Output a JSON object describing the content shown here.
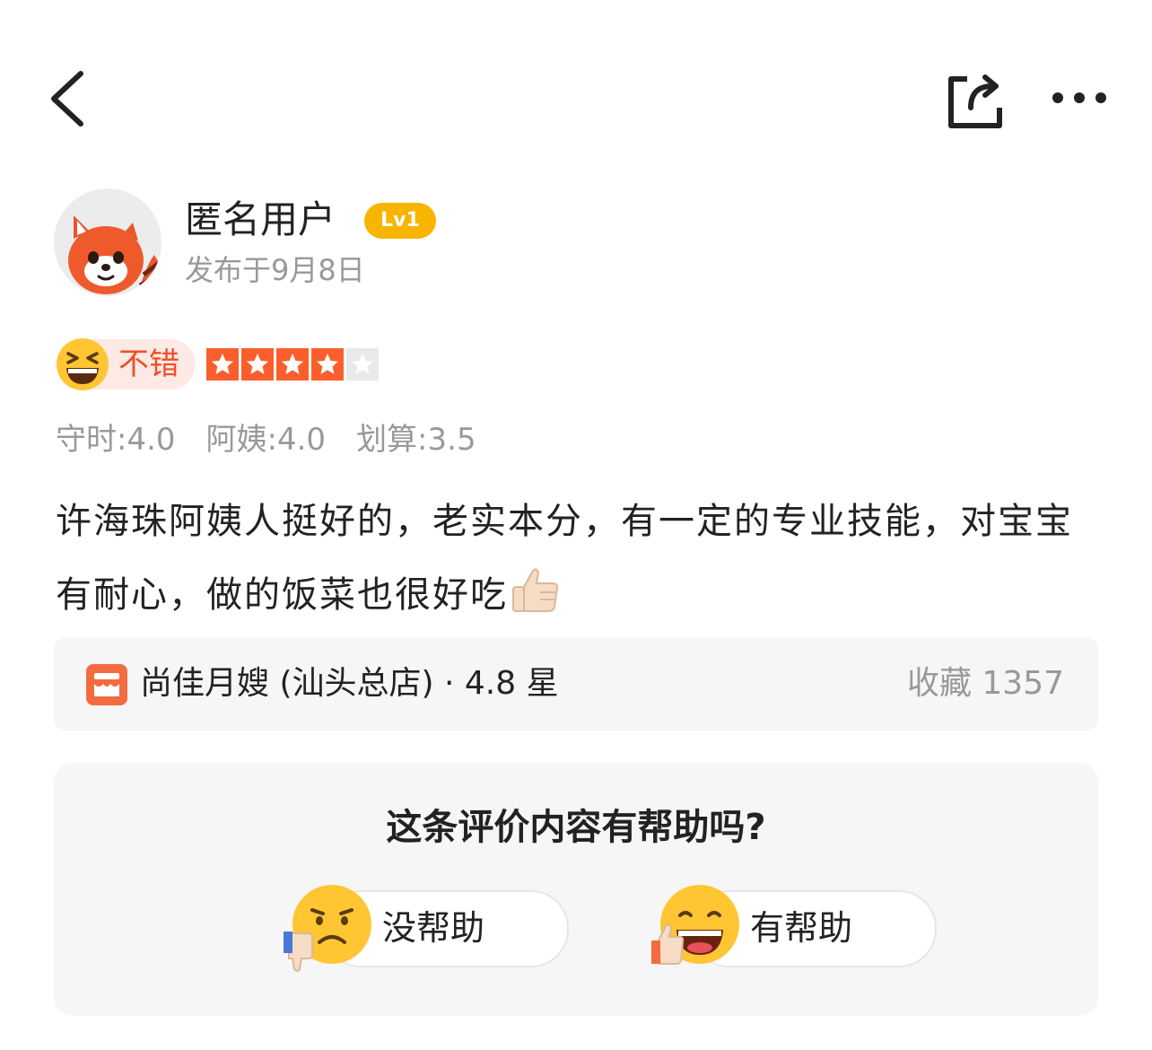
{
  "user": {
    "name": "匿名用户",
    "level": "Lv1",
    "publish_date": "发布于9月8日"
  },
  "rating": {
    "label": "不错",
    "stars": 4,
    "max_stars": 5
  },
  "sub_scores": [
    "守时:4.0",
    "阿姨:4.0",
    "划算:3.5"
  ],
  "review": {
    "text": "许海珠阿姨人挺好的，老实本分，有一定的专业技能，对宝宝有耐心，做的饭菜也很好吃"
  },
  "store": {
    "name": "尚佳月嫂 (汕头总店)",
    "rating_text": " · 4.8 星",
    "favorites": "收藏 1357"
  },
  "helpful": {
    "question": "这条评价内容有帮助吗?",
    "no_label": "没帮助",
    "yes_label": "有帮助"
  },
  "colors": {
    "accent": "#f04f2a",
    "star": "#fa5f2b",
    "star_empty": "#e9e9e9",
    "level_badge": "#f7b500",
    "muted_text": "#999999",
    "card_bg": "#f6f6f6"
  },
  "icons": {
    "back": "chevron-left-icon",
    "share": "share-icon",
    "more": "more-dots-icon",
    "store": "store-icon",
    "rating_emoji": "grinning-squint-emoji",
    "thumbs": "thumbs-up-emoji",
    "vote_no": "frown-thumbs-down-emoji",
    "vote_yes": "grin-thumbs-up-emoji"
  }
}
